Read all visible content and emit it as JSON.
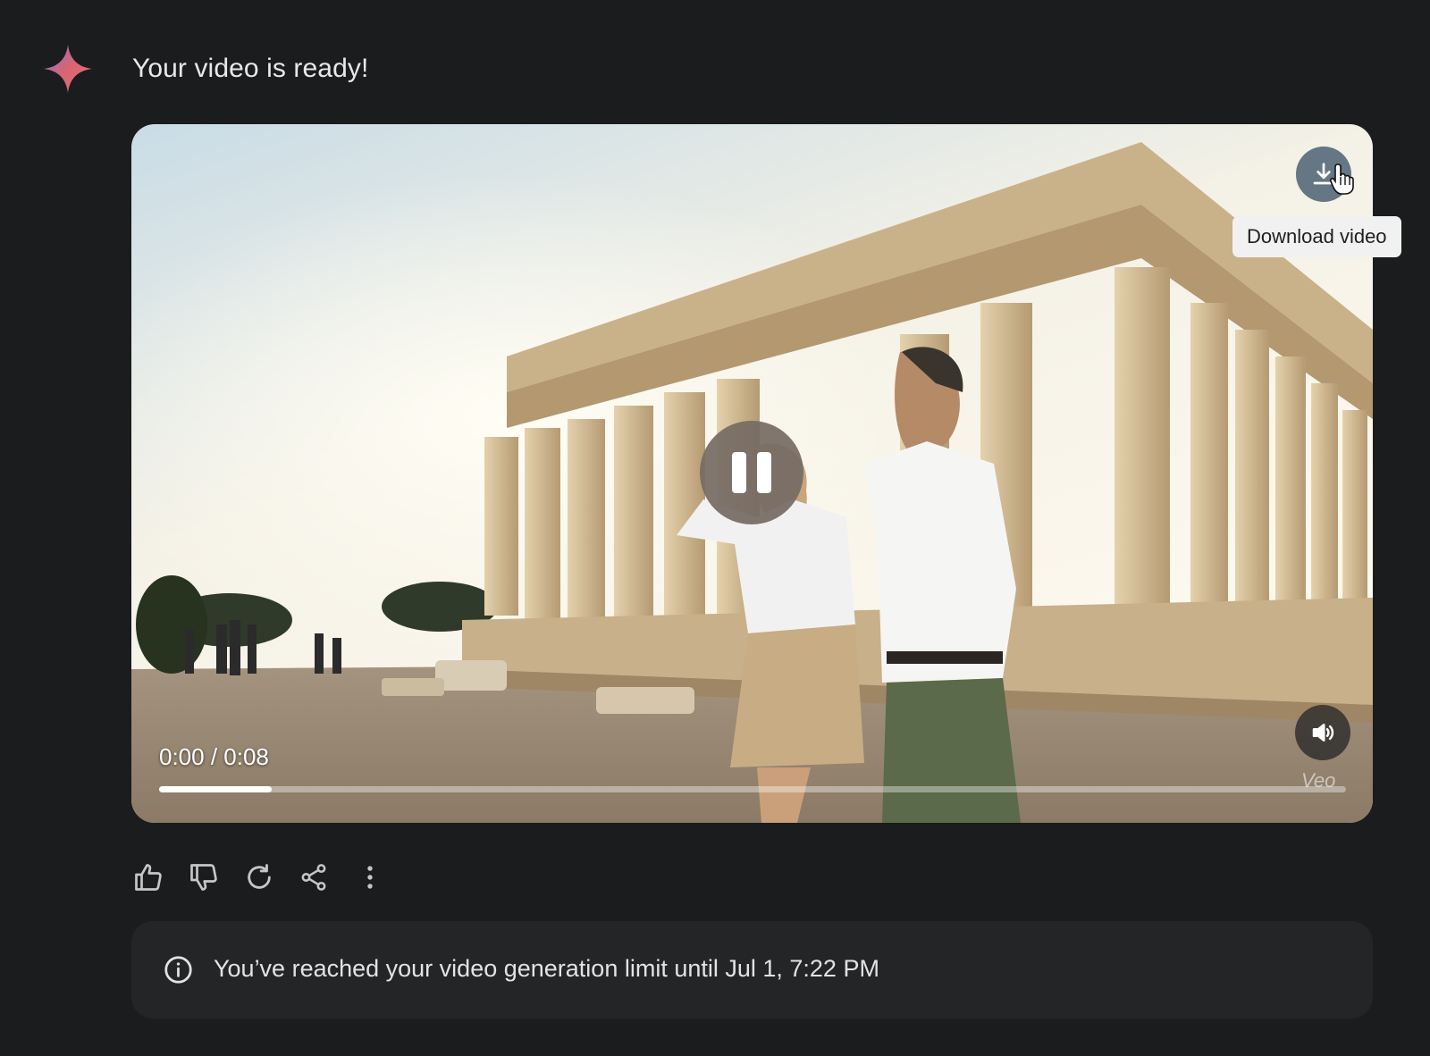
{
  "response": {
    "heading": "Your video is ready!"
  },
  "video": {
    "current_time": "0:00",
    "duration": "0:08",
    "time_display": "0:00 / 0:08",
    "progress_fraction": 0.095,
    "watermark": "Veo",
    "download_tooltip": "Download video"
  },
  "actions": [
    "thumbs-up-icon",
    "thumbs-down-icon",
    "refresh-icon",
    "share-icon",
    "more-vert-icon"
  ],
  "notice": {
    "text": "You’ve reached your video generation limit until Jul 1, 7:22 PM"
  },
  "colors": {
    "background": "#1b1c1d",
    "notice_background": "#232527",
    "spark_start": "#4a8cf5",
    "spark_end": "#d96570"
  }
}
